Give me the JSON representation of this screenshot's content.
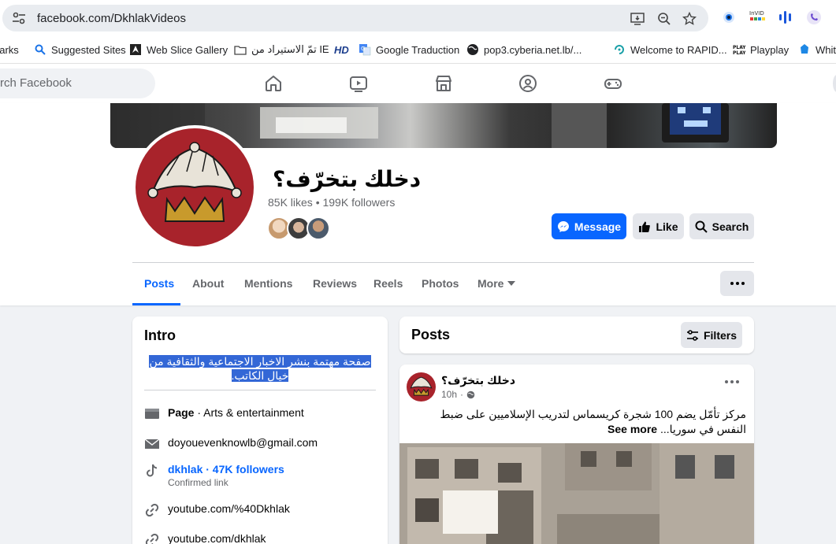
{
  "browser": {
    "url": "facebook.com/DkhlakVideos",
    "bookmarks": [
      {
        "label": "harks",
        "icon": "bookmark-icon"
      },
      {
        "label": "Suggested Sites",
        "icon": "search-icon"
      },
      {
        "label": "Web Slice Gallery",
        "icon": "web-slice-icon"
      },
      {
        "label": "تمّ الاستيراد من IE",
        "icon": "folder-icon"
      },
      {
        "label": "",
        "icon": "hd-icon"
      },
      {
        "label": "Google Traduction",
        "icon": "google-translate-icon"
      },
      {
        "label": "pop3.cyberia.net.lb/...",
        "icon": "globe-icon"
      },
      {
        "label": "Welcome to RAPID...",
        "icon": "rapid-icon"
      },
      {
        "label": "Playplay",
        "icon": "playplay-icon"
      },
      {
        "label": "Whit",
        "icon": "whit-icon"
      }
    ],
    "hd_label": "HD",
    "extensions": [
      "record-icon",
      "invid-icon",
      "audio-bars-icon",
      "viber-icon"
    ]
  },
  "fb_nav": {
    "search_placeholder": "rch Facebook",
    "icons": [
      "home-icon",
      "video-icon",
      "marketplace-icon",
      "groups-icon",
      "gaming-icon"
    ]
  },
  "profile": {
    "name": "دخلك بتخرّف؟",
    "stats": "85K likes • 199K followers",
    "buttons": {
      "message": "Message",
      "like": "Like",
      "search": "Search"
    },
    "colors": {
      "primary": "#0866ff",
      "avatar_bg": "#a8232b"
    }
  },
  "tabs": [
    {
      "label": "Posts",
      "active": true
    },
    {
      "label": "About"
    },
    {
      "label": "Mentions"
    },
    {
      "label": "Reviews"
    },
    {
      "label": "Reels"
    },
    {
      "label": "Photos"
    },
    {
      "label": "More"
    }
  ],
  "intro": {
    "title": "Intro",
    "bio_line1": "صفحة مهتمة بنشر الاخبار الاجتماعية والثقافية من",
    "bio_line2": "خيال الكاتب.",
    "category_label": "Page",
    "category_value": " · Arts & entertainment",
    "email": "doyouevenknowlb@gmail.com",
    "tiktok": "dkhlak · 47K followers",
    "tiktok_sub": "Confirmed link",
    "link1": "youtube.com/%40Dkhlak",
    "link2": "youtube.com/dkhlak"
  },
  "posts": {
    "title": "Posts",
    "filters": "Filters",
    "post": {
      "author": "دخلك بتخرّف؟",
      "time": "10h",
      "text": "مركز تأمّل يضم 100 شجرة كريسماس لتدريب الإسلاميين على ضبط النفس في سوريا...",
      "see_more": "See more"
    }
  }
}
